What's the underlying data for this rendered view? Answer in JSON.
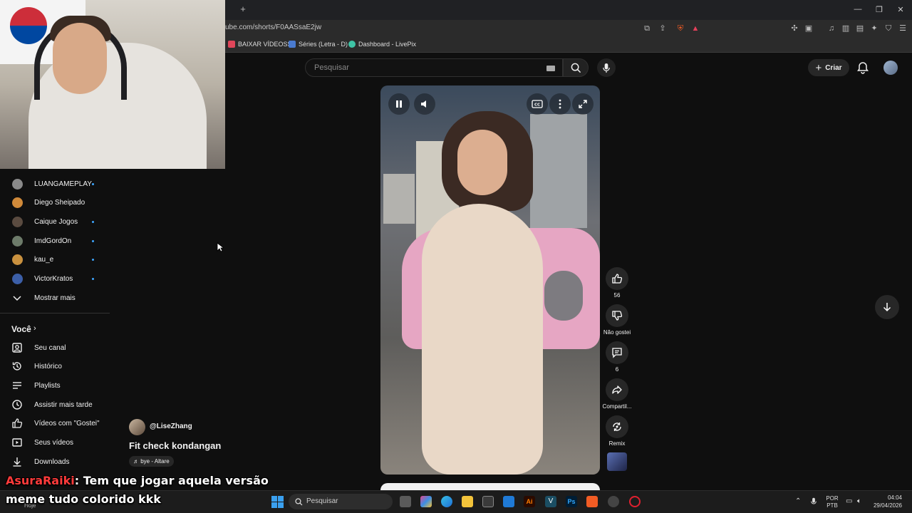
{
  "browser": {
    "url": "ube.com/shorts/F0AASsaE2jw",
    "new_tab_icon": "plus-icon",
    "bookmarks": [
      {
        "label": "BAIXAR VÍDEOSS",
        "color": "#e0465a"
      },
      {
        "label": "Séries (Letra - D)",
        "color": "#4a7bd0"
      },
      {
        "label": "Dashboard - LivePix",
        "color": "#3ec3a5"
      }
    ]
  },
  "header": {
    "search_placeholder": "Pesquisar",
    "create_label": "Criar"
  },
  "sidebar": {
    "subscriptions": [
      {
        "label": "LUANGAMEPLAY",
        "new": true,
        "color": "#8a8a8a"
      },
      {
        "label": "Diego Sheipado",
        "new": false,
        "color": "#d08a3a"
      },
      {
        "label": "Caique Jogos",
        "new": true,
        "color": "#5a4b40"
      },
      {
        "label": "ImdGordOn",
        "new": true,
        "color": "#6d7b6a"
      },
      {
        "label": "kau_e",
        "new": true,
        "color": "#c9913f"
      },
      {
        "label": "VictorKratos",
        "new": true,
        "color": "#3c5fa8"
      }
    ],
    "show_more": "Mostrar mais",
    "you_section": "Você",
    "you_items": [
      {
        "label": "Seu canal",
        "icon": "channel-icon"
      },
      {
        "label": "Histórico",
        "icon": "history-icon"
      },
      {
        "label": "Playlists",
        "icon": "playlists-icon"
      },
      {
        "label": "Assistir mais tarde",
        "icon": "watch-later-icon"
      },
      {
        "label": "Vídeos com \"Gostei\"",
        "icon": "thumb-up-icon"
      },
      {
        "label": "Seus vídeos",
        "icon": "your-videos-icon"
      },
      {
        "label": "Downloads",
        "icon": "download-icon"
      }
    ]
  },
  "short": {
    "channel": "@LiseZhang",
    "title": "Fit check kondangan",
    "sound": "♬ bye - Altare"
  },
  "actions": {
    "likes": "56",
    "dislike_label": "Não gostei",
    "comments": "6",
    "share_label": "Compartil...",
    "remix_label": "Remix"
  },
  "chat": {
    "user": "AsuraRaiki",
    "line1": ": Tem que jogar aquela versão",
    "line2": "meme tudo colorido kkk"
  },
  "taskbar": {
    "search": "Pesquisar",
    "language": "POR",
    "layout": "PTB",
    "time": "04:04",
    "date": "29/04/2026",
    "today": "Hoje"
  }
}
